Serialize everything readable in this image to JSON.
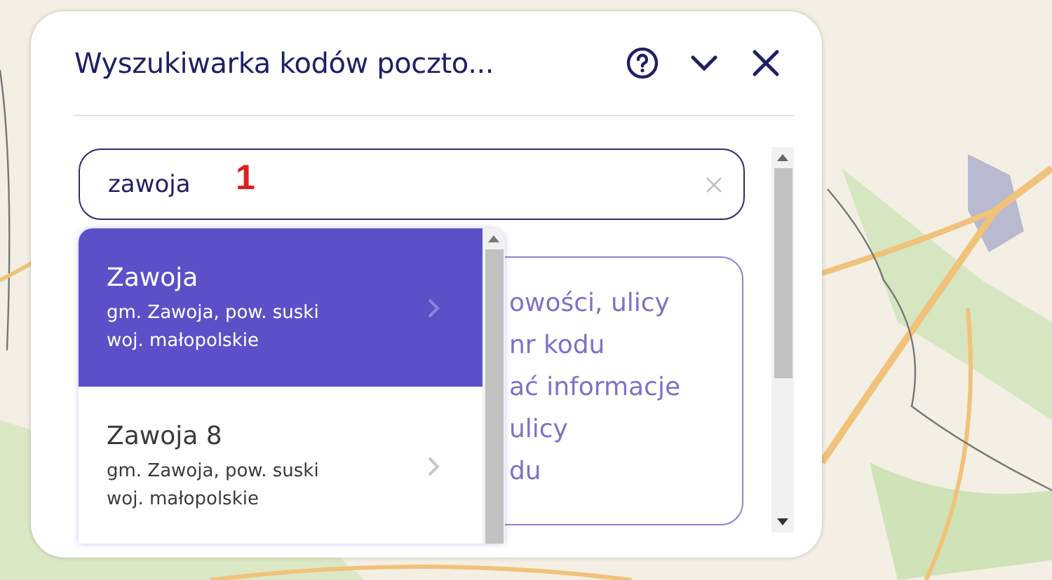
{
  "panel": {
    "title": "Wyszukiwarka kodów poczto...",
    "search": {
      "value": "zawoja"
    },
    "annotation": "1",
    "info_lines": [
      "owości, ulicy",
      "nr kodu",
      "ać informacje",
      "ulicy",
      "du"
    ],
    "results": [
      {
        "name": "Zawoja",
        "details": [
          "gm. Zawoja, pow. suski",
          "woj. małopolskie"
        ],
        "selected": true
      },
      {
        "name": "Zawoja 8",
        "details": [
          "gm. Zawoja, pow. suski",
          "woj. małopolskie"
        ],
        "selected": false
      }
    ]
  }
}
